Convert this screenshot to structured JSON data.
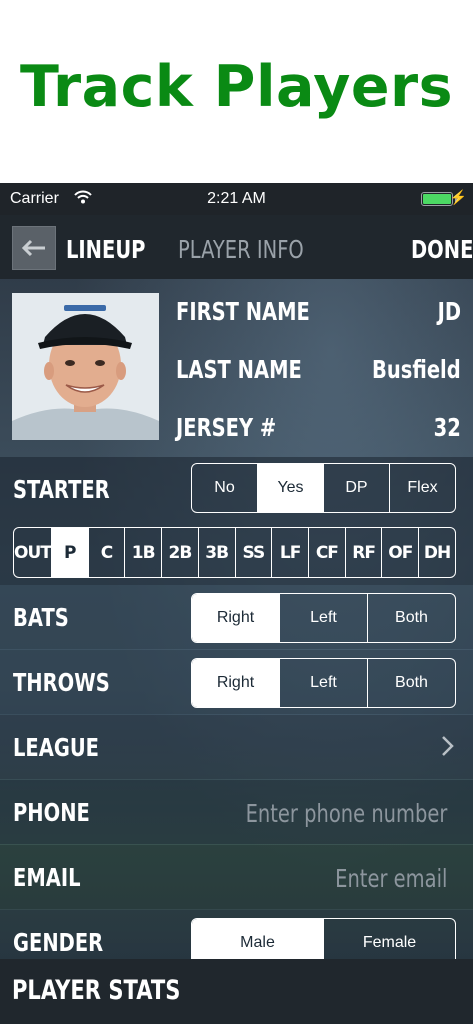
{
  "banner": {
    "title": "Track Players"
  },
  "status_bar": {
    "carrier": "Carrier",
    "time": "2:21 AM"
  },
  "nav": {
    "back_icon": "arrow-left-icon",
    "back_label": "LINEUP",
    "title": "PLAYER INFO",
    "done_label": "DONE"
  },
  "player": {
    "first_name_label": "FIRST NAME",
    "first_name": "JD",
    "last_name_label": "LAST NAME",
    "last_name": "Busfield",
    "jersey_label": "JERSEY #",
    "jersey": "32"
  },
  "starter": {
    "label": "STARTER",
    "options": [
      "No",
      "Yes",
      "DP",
      "Flex"
    ],
    "selected": "Yes"
  },
  "positions": {
    "options": [
      "OUT",
      "P",
      "C",
      "1B",
      "2B",
      "3B",
      "SS",
      "LF",
      "CF",
      "RF",
      "OF",
      "DH"
    ],
    "selected": "P"
  },
  "bats": {
    "label": "BATS",
    "options": [
      "Right",
      "Left",
      "Both"
    ],
    "selected": "Right"
  },
  "throws": {
    "label": "THROWS",
    "options": [
      "Right",
      "Left",
      "Both"
    ],
    "selected": "Right"
  },
  "league": {
    "label": "LEAGUE",
    "chevron_icon": "chevron-right-icon"
  },
  "phone": {
    "label": "PHONE",
    "placeholder": "Enter phone number",
    "value": ""
  },
  "email": {
    "label": "EMAIL",
    "placeholder": "Enter email",
    "value": ""
  },
  "gender": {
    "label": "GENDER",
    "options": [
      "Male",
      "Female"
    ],
    "selected": "Male"
  },
  "footer": {
    "label": "PLAYER STATS"
  },
  "colors": {
    "brand_green": "#0a8a14",
    "nav_bg": "#20272d",
    "battery": "#4cd964"
  }
}
